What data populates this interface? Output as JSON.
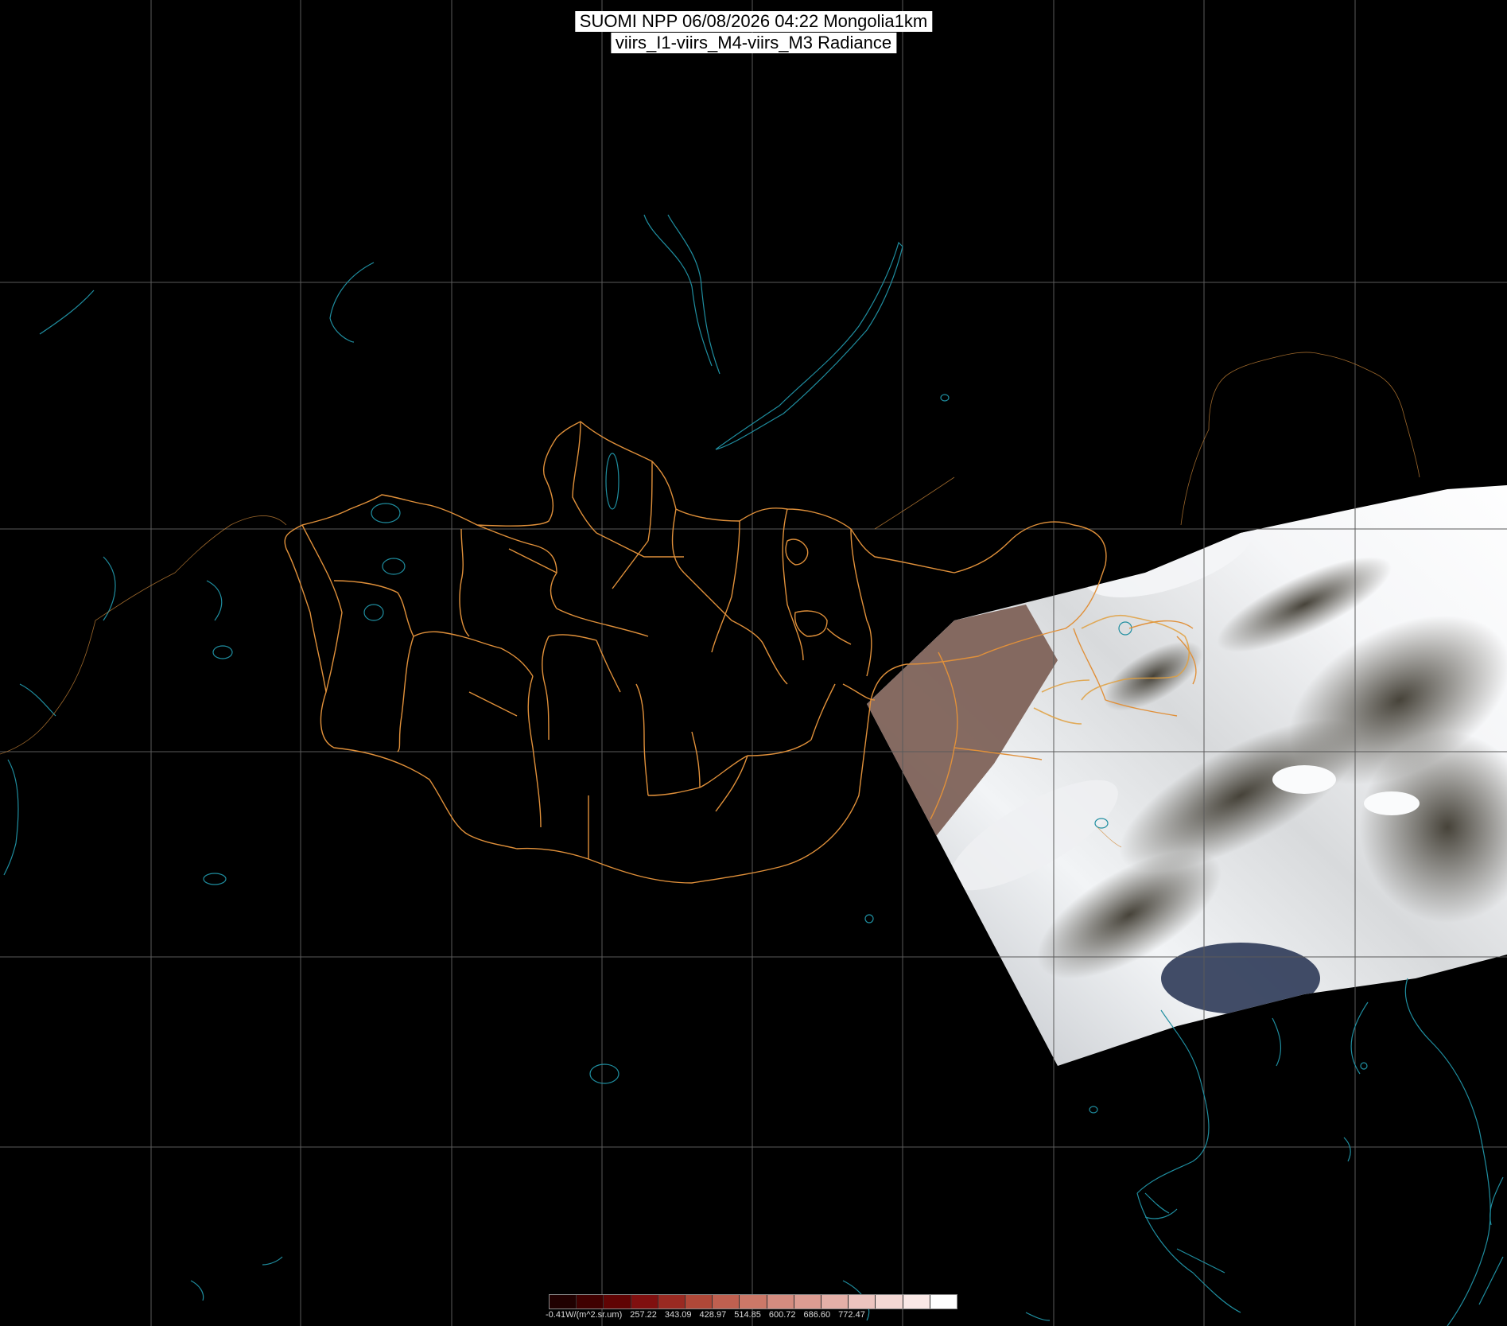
{
  "header": {
    "line1": "SUOMI NPP 06/08/2026 04:22 Mongolia1km",
    "line2": "viirs_I1-viirs_M4-viirs_M3 Radiance"
  },
  "colors": {
    "background": "#000000",
    "grid": "#5a5a5a",
    "admin_border": "#e0903a",
    "coastline": "#1f8ea0",
    "cloud": "#f4f6f8",
    "land": "#4a4638",
    "desert": "#8a6a5e",
    "sea": "#2b3550"
  },
  "map": {
    "region": "Mongolia1km",
    "overlay": "satellite swath (true color)"
  },
  "colorbar": {
    "labels": [
      "-0.41W/(m^2.sr.um)",
      "257.22",
      "343.09",
      "428.97",
      "514.85",
      "600.72",
      "686.60",
      "772.47"
    ],
    "colors": [
      "#200000",
      "#400000",
      "#600404",
      "#801010",
      "#9a2a22",
      "#b04838",
      "#c06050",
      "#cc7868",
      "#d48c80",
      "#dc9c92",
      "#e4b0a8",
      "#ecc4bf",
      "#f4d8d4",
      "#fae8e6",
      "#ffffff"
    ]
  }
}
